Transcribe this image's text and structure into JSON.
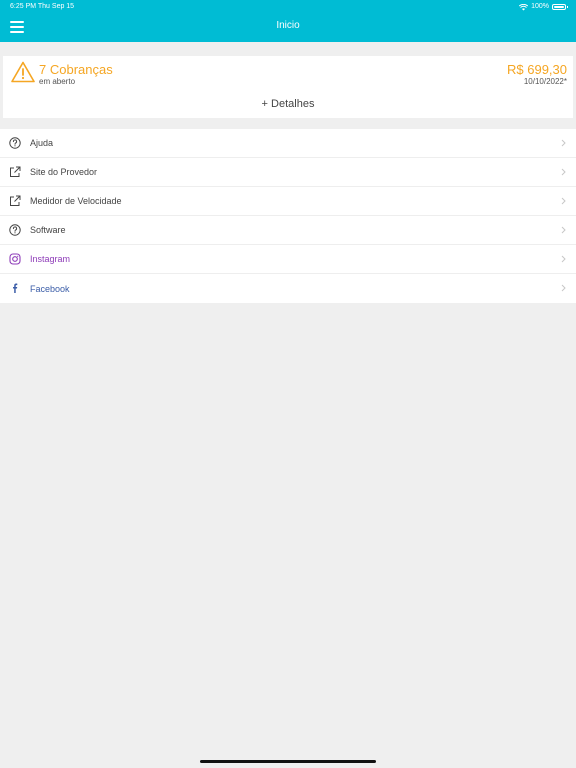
{
  "status_bar": {
    "time_date": "6:25 PM   Thu Sep 15",
    "battery": "100%"
  },
  "header": {
    "title": "Inicio"
  },
  "billing_card": {
    "title": "7 Cobranças",
    "subtitle": "em aberto",
    "amount": "R$ 699,30",
    "date": "10/10/2022*",
    "details_label": "+ Detalhes"
  },
  "menu": {
    "items": [
      {
        "label": "Ajuda",
        "icon": "help-circle-icon"
      },
      {
        "label": "Site do Provedor",
        "icon": "external-link-icon"
      },
      {
        "label": "Medidor de Velocidade",
        "icon": "external-link-icon"
      },
      {
        "label": "Software",
        "icon": "help-circle-icon"
      },
      {
        "label": "Instagram",
        "icon": "instagram-icon"
      },
      {
        "label": "Facebook",
        "icon": "facebook-icon"
      }
    ]
  },
  "colors": {
    "header": "#00bcd4",
    "warning": "#f5a623",
    "instagram": "#8e3bb8",
    "facebook": "#3b5da8"
  }
}
